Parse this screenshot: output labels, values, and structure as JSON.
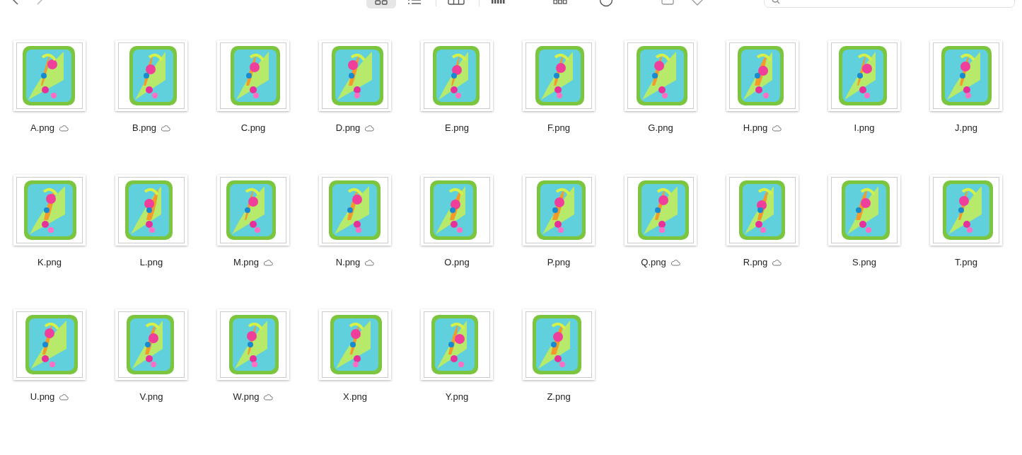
{
  "view_buttons": [
    {
      "kind": "icons",
      "selected": true
    },
    {
      "kind": "list",
      "selected": false
    },
    {
      "kind": "columns",
      "selected": false
    },
    {
      "kind": "gallery",
      "selected": false
    }
  ],
  "files": [
    {
      "name": "A.png",
      "cloud": true
    },
    {
      "name": "B.png",
      "cloud": true
    },
    {
      "name": "C.png",
      "cloud": false
    },
    {
      "name": "D.png",
      "cloud": true
    },
    {
      "name": "E.png",
      "cloud": false
    },
    {
      "name": "F.png",
      "cloud": false
    },
    {
      "name": "G.png",
      "cloud": false
    },
    {
      "name": "H.png",
      "cloud": true
    },
    {
      "name": "I.png",
      "cloud": false
    },
    {
      "name": "J.png",
      "cloud": false
    },
    {
      "name": "K.png",
      "cloud": false
    },
    {
      "name": "L.png",
      "cloud": false
    },
    {
      "name": "M.png",
      "cloud": true
    },
    {
      "name": "N.png",
      "cloud": true
    },
    {
      "name": "O.png",
      "cloud": false
    },
    {
      "name": "P.png",
      "cloud": false
    },
    {
      "name": "Q.png",
      "cloud": true
    },
    {
      "name": "R.png",
      "cloud": true
    },
    {
      "name": "S.png",
      "cloud": false
    },
    {
      "name": "T.png",
      "cloud": false
    },
    {
      "name": "U.png",
      "cloud": true
    },
    {
      "name": "V.png",
      "cloud": false
    },
    {
      "name": "W.png",
      "cloud": true
    },
    {
      "name": "X.png",
      "cloud": false
    },
    {
      "name": "Y.png",
      "cloud": false
    },
    {
      "name": "Z.png",
      "cloud": false
    }
  ]
}
